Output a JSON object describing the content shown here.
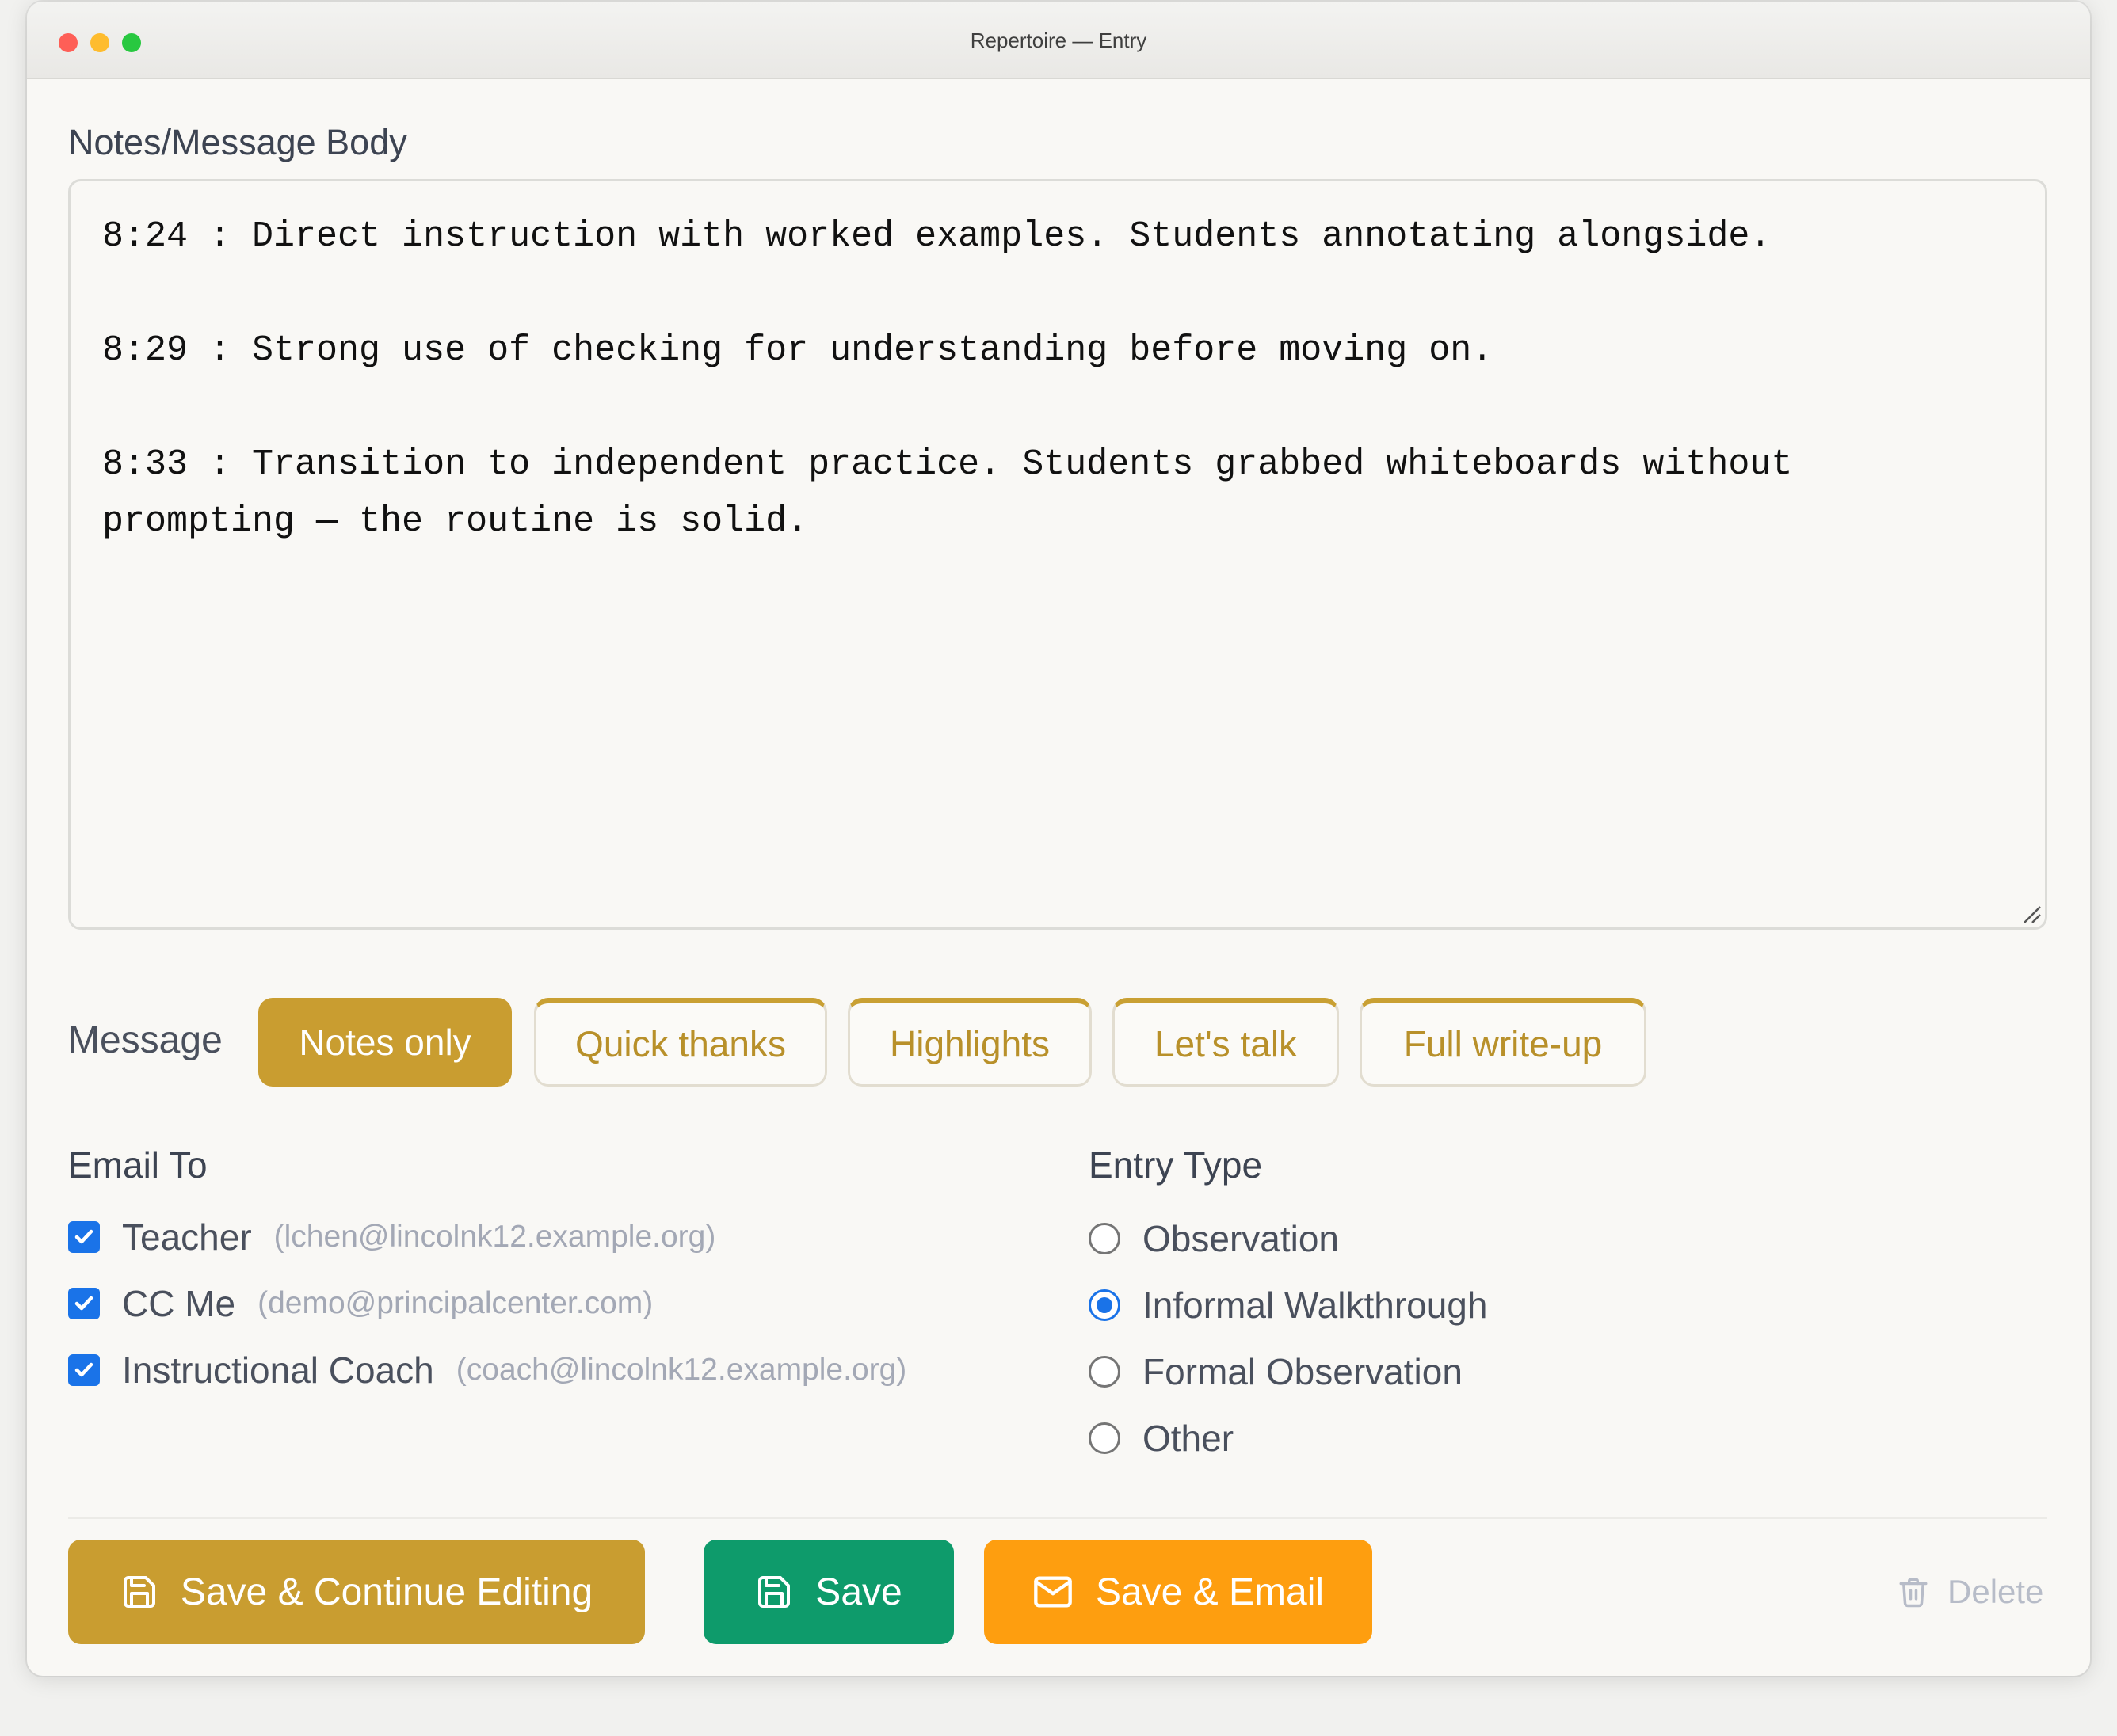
{
  "window": {
    "title": "Repertoire — Entry"
  },
  "notes": {
    "label": "Notes/Message Body",
    "lines": [
      "8:24 : Direct instruction with worked examples. Students annotating alongside.",
      "8:29 : Strong use of checking for understanding before moving on.",
      "8:33 : Transition to independent practice. Students grabbed whiteboards without",
      "prompting — the routine is solid."
    ]
  },
  "message": {
    "label": "Message",
    "options": [
      "Notes only",
      "Quick thanks",
      "Highlights",
      "Let's talk",
      "Full write-up"
    ],
    "selected": "Notes only"
  },
  "email_to": {
    "label": "Email To",
    "recipients": [
      {
        "name": "Teacher",
        "email": "(lchen@lincolnk12.example.org)",
        "checked": true
      },
      {
        "name": "CC Me",
        "email": "(demo@principalcenter.com)",
        "checked": true
      },
      {
        "name": "Instructional Coach",
        "email": "(coach@lincolnk12.example.org)",
        "checked": true
      }
    ]
  },
  "entry_type": {
    "label": "Entry Type",
    "options": [
      "Observation",
      "Informal Walkthrough",
      "Formal Observation",
      "Other"
    ],
    "selected": "Informal Walkthrough"
  },
  "actions": {
    "save_continue": "Save & Continue Editing",
    "save": "Save",
    "save_email": "Save & Email",
    "delete": "Delete"
  },
  "colors": {
    "accent_gold": "#c99d30",
    "save_green": "#0e9b6b",
    "email_orange": "#fe9e0f",
    "checkbox_blue": "#1a73e8"
  },
  "icons": {
    "save_continue": "floppy-disk-icon",
    "save": "floppy-disk-icon",
    "save_email": "envelope-icon",
    "delete": "trash-icon"
  }
}
